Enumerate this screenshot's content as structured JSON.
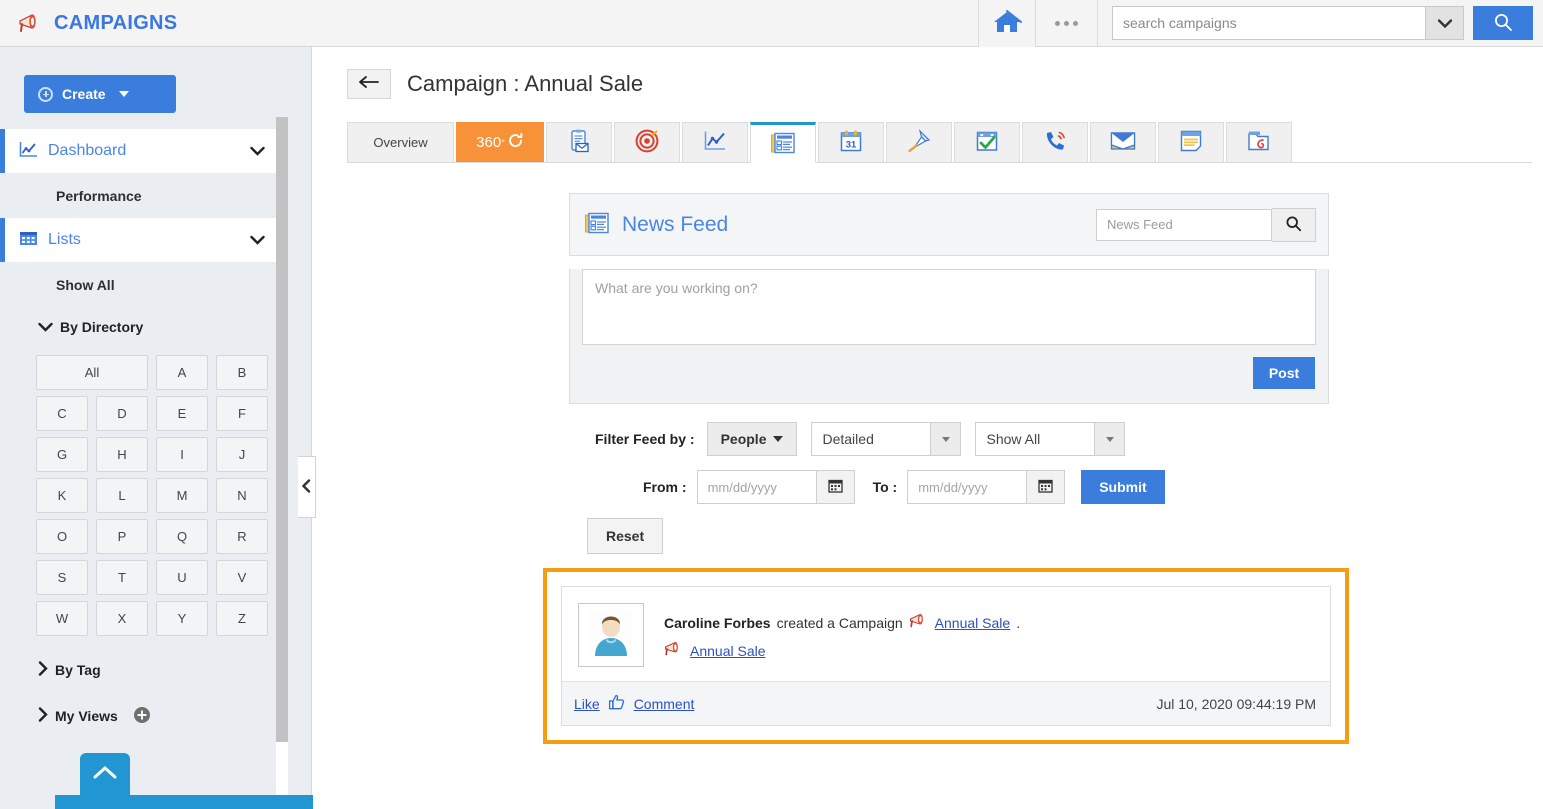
{
  "header": {
    "brand": "CAMPAIGNS",
    "brand_icon": "megaphone-icon",
    "brand_color": "#3b77e3",
    "home_icon": "home-icon",
    "more_icon": "more-dots-icon",
    "search_placeholder": "search campaigns",
    "search_value": "",
    "search_caret_icon": "chevron-down-icon",
    "search_button_icon": "search-icon",
    "search_button_color": "#3b7ddd"
  },
  "sidebar": {
    "create_label": "Create",
    "create_icon": "plus-circle-icon",
    "create_caret_icon": "caret-down-icon",
    "nav": [
      {
        "label": "Dashboard",
        "icon": "chart-line-icon",
        "type": "main",
        "expanded": true
      },
      {
        "label": "Performance",
        "type": "sub"
      },
      {
        "label": "Lists",
        "icon": "grid-table-icon",
        "type": "main",
        "expanded": true
      },
      {
        "label": "Show All",
        "type": "sub"
      }
    ],
    "groups": [
      {
        "label": "By Directory",
        "expanded": true
      },
      {
        "label": "By Tag",
        "expanded": false
      },
      {
        "label": "My Views",
        "expanded": false,
        "add_icon": "plus-circle-icon"
      }
    ],
    "directory_letters": [
      "All",
      "A",
      "B",
      "C",
      "D",
      "E",
      "F",
      "G",
      "H",
      "I",
      "J",
      "K",
      "L",
      "M",
      "N",
      "O",
      "P",
      "Q",
      "R",
      "S",
      "T",
      "U",
      "V",
      "W",
      "X",
      "Y",
      "Z"
    ],
    "collapse_icon": "chevron-left-icon",
    "bottom_tab_icon": "chevron-up-icon",
    "bottom_bar_color": "#2196d3"
  },
  "main": {
    "back_icon": "arrow-left-icon",
    "page_title": "Campaign : Annual Sale",
    "tabs": [
      {
        "label": "Overview",
        "kind": "text"
      },
      {
        "label": "360",
        "kind": "degree",
        "active_style": "orange",
        "icon": "refresh-360-icon"
      },
      {
        "label": "",
        "kind": "icon",
        "icon": "clipboard-mail-icon"
      },
      {
        "label": "",
        "kind": "icon",
        "icon": "target-icon"
      },
      {
        "label": "",
        "kind": "icon",
        "icon": "chart-line-icon"
      },
      {
        "label": "",
        "kind": "icon",
        "icon": "news-feed-icon",
        "active": true
      },
      {
        "label": "",
        "kind": "icon",
        "icon": "calendar-31-icon"
      },
      {
        "label": "",
        "kind": "icon",
        "icon": "pin-icon"
      },
      {
        "label": "",
        "kind": "icon",
        "icon": "task-check-icon"
      },
      {
        "label": "",
        "kind": "icon",
        "icon": "phone-call-icon"
      },
      {
        "label": "",
        "kind": "icon",
        "icon": "email-icon"
      },
      {
        "label": "",
        "kind": "icon",
        "icon": "notes-icon"
      },
      {
        "label": "",
        "kind": "icon",
        "icon": "attachment-icon"
      }
    ],
    "active_tab_accent": "#2196d3",
    "tab360_color": "#f79239"
  },
  "feed": {
    "title": "News Feed",
    "title_icon": "news-feed-icon",
    "search_placeholder": "News Feed",
    "search_value": "",
    "search_icon": "search-icon",
    "composer_placeholder": "What are you working on?",
    "composer_value": "",
    "post_label": "Post",
    "filter_label": "Filter Feed by :",
    "people_label": "People",
    "detail_value": "Detailed",
    "showall_value": "Show All",
    "from_label": "From :",
    "from_placeholder": "mm/dd/yyyy",
    "from_value": "",
    "to_label": "To :",
    "to_placeholder": "mm/dd/yyyy",
    "to_value": "",
    "calendar_icon": "calendar-icon",
    "submit_label": "Submit",
    "reset_label": "Reset",
    "highlight_color": "#f59c13",
    "post": {
      "avatar_icon": "user-avatar-icon",
      "author": "Caroline Forbes",
      "action": "created a Campaign",
      "entity_link": "Annual Sale",
      "trailing_period": ".",
      "entity_icon": "megaphone-icon",
      "attached_link": "Annual Sale",
      "like_label": "Like",
      "like_icon": "thumbs-up-icon",
      "comment_label": "Comment",
      "timestamp": "Jul 10, 2020 09:44:19 PM"
    }
  }
}
